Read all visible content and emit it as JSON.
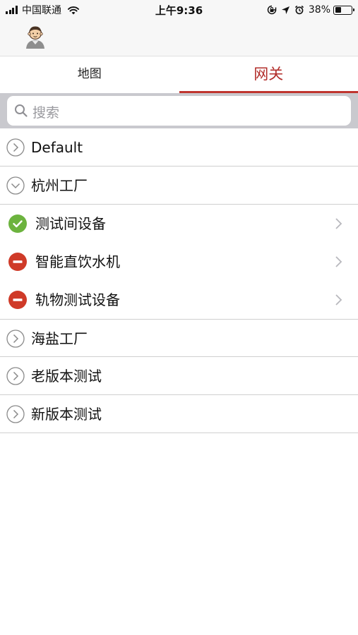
{
  "status_bar": {
    "carrier": "中国联通",
    "time": "上午9:36",
    "battery_percent": "38%",
    "battery_level": 0.38,
    "icons": [
      "signal-icon",
      "wifi-icon",
      "orientation-lock-icon",
      "location-arrow-icon",
      "alarm-icon",
      "battery-icon"
    ]
  },
  "nav": {
    "avatar_icon": "user-avatar-icon"
  },
  "tabs": [
    {
      "label": "地图",
      "active": false
    },
    {
      "label": "网关",
      "active": true
    }
  ],
  "colors": {
    "accent": "#c0352f",
    "online": "#6cb33e",
    "offline": "#cf3a28",
    "divider": "#cfcfcf",
    "search_bg": "#c9c9ce"
  },
  "search": {
    "placeholder": "搜索"
  },
  "list": {
    "groups": [
      {
        "label": "Default",
        "expanded": false
      },
      {
        "label": "杭州工厂",
        "expanded": true,
        "devices": [
          {
            "label": "测试间设备",
            "status": "online"
          },
          {
            "label": "智能直饮水机",
            "status": "offline"
          },
          {
            "label": "轨物测试设备",
            "status": "offline"
          }
        ]
      },
      {
        "label": "海盐工厂",
        "expanded": false
      },
      {
        "label": "老版本测试",
        "expanded": false
      },
      {
        "label": "新版本测试",
        "expanded": false
      }
    ]
  }
}
